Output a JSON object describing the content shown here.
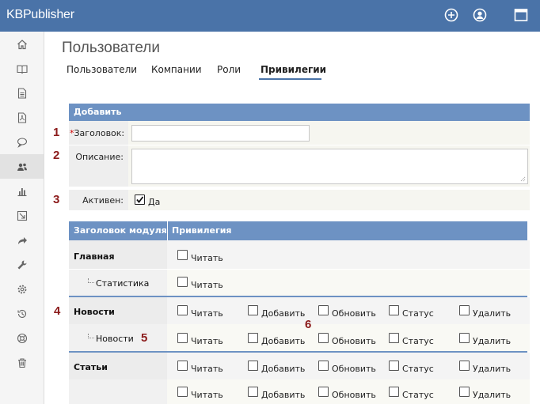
{
  "app": {
    "brand": "KBPublisher"
  },
  "topbar": {
    "icons": [
      "add-circle-icon",
      "user-circle-icon",
      "window-icon"
    ]
  },
  "sidebar": {
    "items": [
      "home-icon",
      "book-icon",
      "document-icon",
      "pdf-icon",
      "comments-icon",
      "users-icon",
      "chart-icon",
      "import-icon",
      "share-icon",
      "wrench-icon",
      "settings-gear-icon",
      "history-icon",
      "help-lifebuoy-icon",
      "trash-icon"
    ],
    "active_index": 5
  },
  "page": {
    "title": "Пользователи",
    "tabs": [
      {
        "label": "Пользователи",
        "active": false
      },
      {
        "label": "Компании",
        "active": false
      },
      {
        "label": "Роли",
        "active": false
      },
      {
        "label": "Привилегии",
        "active": true
      }
    ]
  },
  "form": {
    "section_title": "Добавить",
    "required_mark": "*",
    "title_label": "Заголовок:",
    "title_value": "",
    "description_label": "Описание:",
    "description_value": "",
    "active_label": "Активен:",
    "active_checked": true,
    "active_option": "Да"
  },
  "annotations": [
    "1",
    "2",
    "3",
    "4",
    "5",
    "6"
  ],
  "permissions": {
    "headers": [
      "Заголовок модуля",
      "Привилегия"
    ],
    "rows": [
      {
        "module": "Главная",
        "indent": false,
        "privileges": [
          "Читать"
        ]
      },
      {
        "module": "Статистика",
        "indent": true,
        "privileges": [
          "Читать"
        ]
      },
      {
        "module": "Новости",
        "indent": false,
        "privileges": [
          "Читать",
          "Добавить",
          "Обновить",
          "Статус",
          "Удалить"
        ]
      },
      {
        "module": "Новости",
        "indent": true,
        "privileges": [
          "Читать",
          "Добавить",
          "Обновить",
          "Статус",
          "Удалить"
        ]
      },
      {
        "module": "Статьи",
        "indent": false,
        "privileges": [
          "Читать",
          "Добавить",
          "Обновить",
          "Статус",
          "Удалить"
        ]
      },
      {
        "module": "",
        "indent": false,
        "privileges": [
          "Читать",
          "Добавить",
          "Обновить",
          "Статус",
          "Удалить"
        ]
      }
    ]
  },
  "colors": {
    "topbar": "#4a73a8",
    "header": "#6d92c3",
    "annotation": "#8b1a1a",
    "required": "#d10000"
  }
}
